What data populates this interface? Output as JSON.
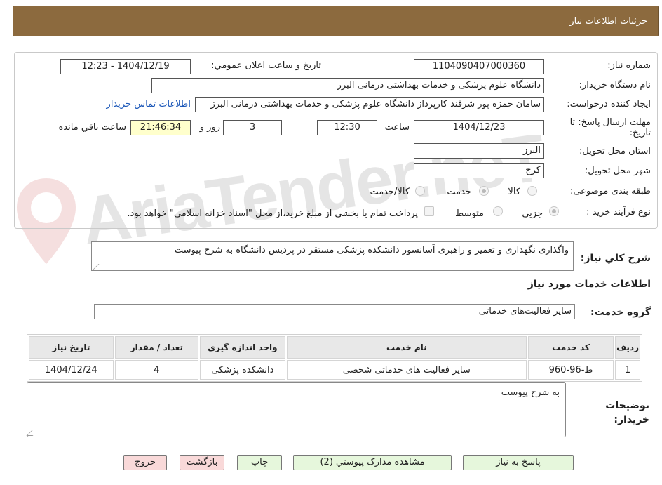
{
  "header": {
    "title": "جزئیات اطلاعات نیاز"
  },
  "form": {
    "need_number_label": "شماره نیاز:",
    "need_number": "1104090407000360",
    "announce_label": "تاریخ و ساعت اعلان عمومي:",
    "announce_value": "1404/12/19 - 12:23",
    "buyer_org_label": "نام دستگاه خریدار:",
    "buyer_org": "دانشگاه علوم پزشکی و خدمات بهداشتی  درمانی البرز",
    "requester_label": "ایجاد کننده درخواست:",
    "requester": "سامان حمزه پور شرفند کارپرداز دانشگاه علوم پزشکی و خدمات بهداشتی  درمانی البرز",
    "contact_link": "اطلاعات تماس خریدار",
    "deadline_label_line1": "مهلت ارسال پاسخ: تا",
    "deadline_label_line2": "تاریخ:",
    "deadline_date": "1404/12/23",
    "time_label": "ساعت",
    "deadline_time": "12:30",
    "days_value": "3",
    "days_label": "روز و",
    "remaining_time": "21:46:34",
    "remaining_label": "ساعت باقي مانده",
    "province_label": "استان محل تحویل:",
    "province": "البرز",
    "city_label": "شهر محل تحویل:",
    "city": "کرج",
    "category_label": "طبقه بندی موضوعی:",
    "category_options": [
      "کالا",
      "خدمت",
      "کالا/خدمت"
    ],
    "category_selected": "خدمت",
    "process_label": "نوع فرآیند خرید :",
    "process_options": [
      "جزيي",
      "متوسط"
    ],
    "process_selected": "جزيي",
    "payment_note": "پرداخت تمام یا بخشی از مبلغ خرید،از محل \"اسناد خزانه اسلامی\" خواهد بود."
  },
  "summary": {
    "label": "شرح کلي نیاز:",
    "text": "واگذاری نگهداری و تعمیر و راهبری آسانسور دانشکده پزشکی مستقر در پردیس دانشگاه به شرح پیوست"
  },
  "services": {
    "section_title": "اطلاعات خدمات مورد نیاز",
    "group_label": "گروه خدمت:",
    "group_value": "سایر فعالیت‌های خدماتی",
    "columns": [
      "ردیف",
      "کد خدمت",
      "نام خدمت",
      "واحد اندازه گیری",
      "تعداد / مقدار",
      "تاریخ نیاز"
    ],
    "rows": [
      [
        "1",
        "ط-96-960",
        "سایر فعالیت های خدماتی شخصی",
        "دانشکده پزشکی",
        "4",
        "1404/12/24"
      ]
    ]
  },
  "buyer_notes": {
    "label_line1": "توضیحات",
    "label_line2": "خریدار:",
    "text": "به شرح پیوست"
  },
  "buttons": {
    "reply": "پاسخ به نیاز",
    "attachments": "مشاهده مدارک پیوستي (2)",
    "print": "چاپ",
    "back": "بازگشت",
    "exit": "خروج"
  },
  "watermark": {
    "text": "AriaTender.neT"
  },
  "colors": {
    "header_bg": "#8c6a3e",
    "link": "#1b57b8",
    "remaining_bg": "#ffffcc",
    "green_button": "#e6f7dc",
    "pink_button": "#f9d9d9"
  }
}
